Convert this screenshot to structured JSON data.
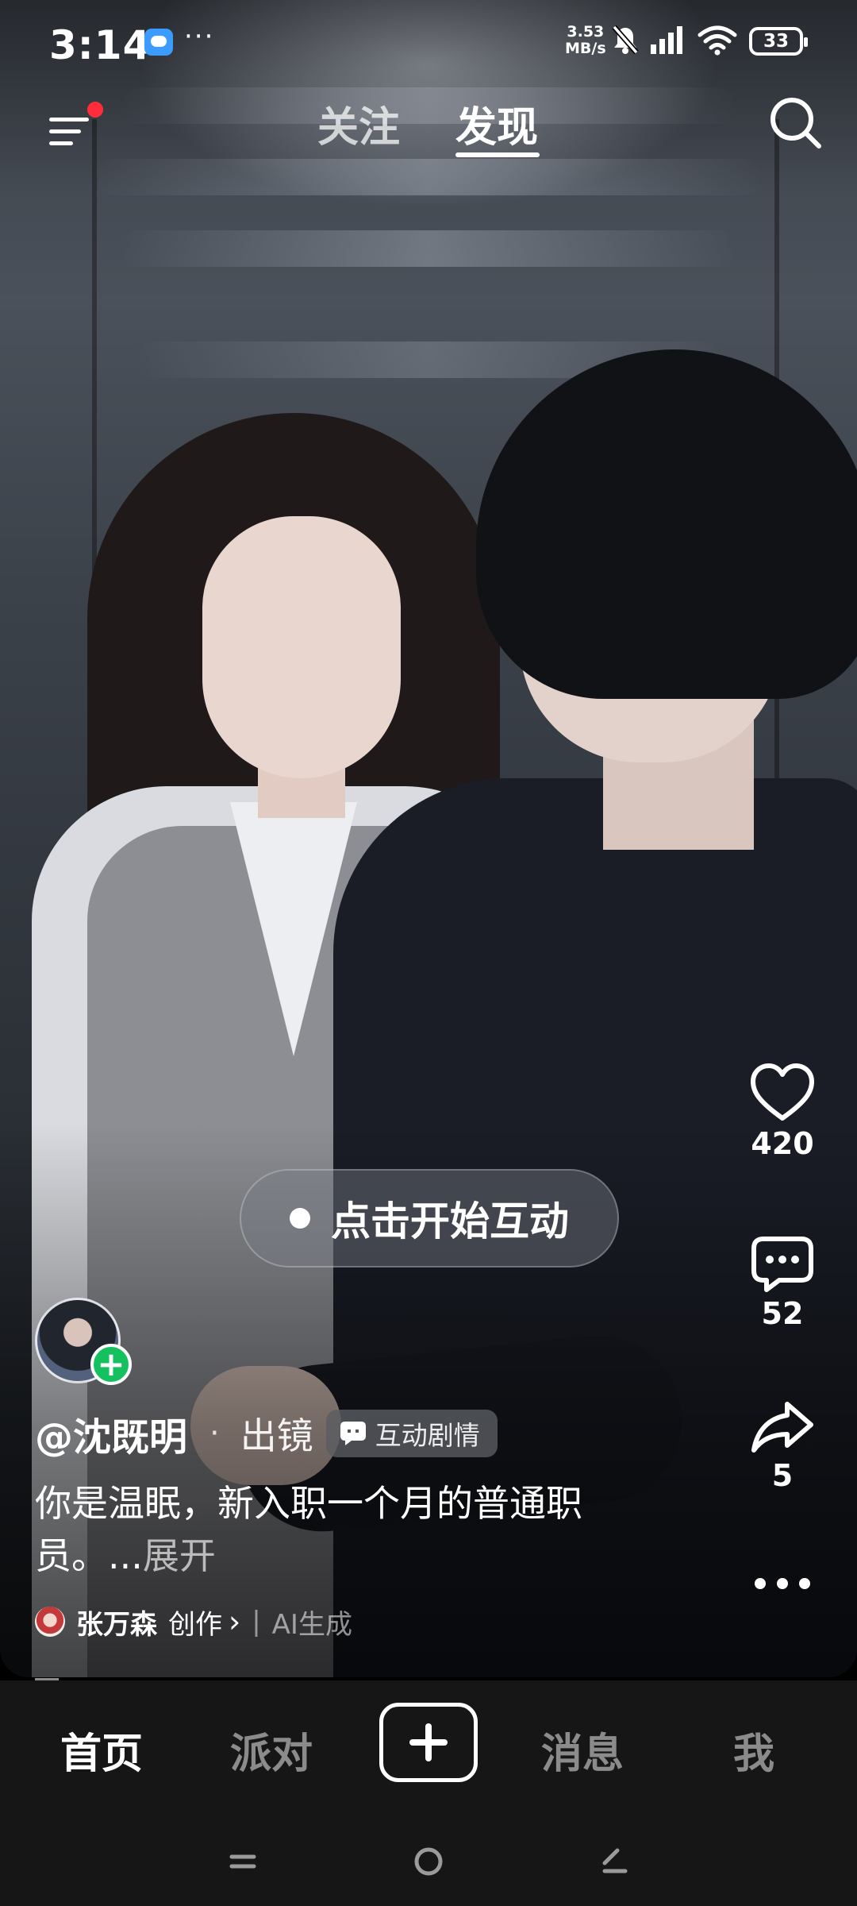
{
  "status_bar": {
    "time": "3:14",
    "more": "···",
    "net_speed_value": "3.53",
    "net_speed_unit": "MB/s",
    "battery": "33"
  },
  "top_nav": {
    "tabs": [
      {
        "label": "关注",
        "active": false
      },
      {
        "label": "发现",
        "active": true
      }
    ],
    "menu_has_badge": true
  },
  "actions": {
    "likes": "420",
    "comments": "52",
    "shares": "5"
  },
  "interact_button": {
    "label": "点击开始互动"
  },
  "author": {
    "name": "@沈既明",
    "separator": "·",
    "role": "出镜",
    "tag": "互动剧情",
    "follow": "+"
  },
  "caption": {
    "text": "你是温眠，新入职一个月的普通职员。...",
    "expand": "展开"
  },
  "credit": {
    "creator": "张万森",
    "label": "创作",
    "chevron": "›",
    "ai_label": "AI生成"
  },
  "bottom_tabs": [
    {
      "label": "首页",
      "active": true
    },
    {
      "label": "派对",
      "active": false
    },
    {
      "label": "消息",
      "active": false
    },
    {
      "label": "我",
      "active": false
    }
  ],
  "colors": {
    "follow_green": "#14c15e",
    "badge_red": "#ff2d3c",
    "tab_bar_bg": "#161616"
  }
}
